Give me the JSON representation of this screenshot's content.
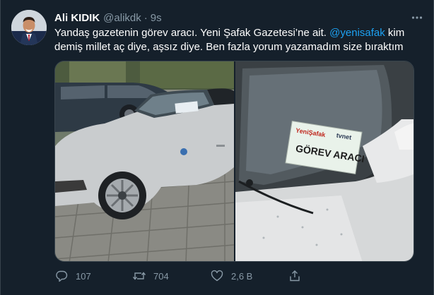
{
  "tweet": {
    "author_name": "Ali KIDIK",
    "author_handle": "@alikdk",
    "separator": "·",
    "time": "9s",
    "text_before": "Yandaş gazetenin görev aracı. Yeni Şafak Gazetesi’ne ait. ",
    "mention": "@yenisafak",
    "text_after": " kim demiş millet aç diye, aşsız diye. Ben fazla yorum yazamadım size bıraktım",
    "more_icon": "more-horizontal-icon"
  },
  "media": {
    "photos": [
      {
        "icon": "car-photo",
        "description_visible": false
      },
      {
        "icon": "windshield-sign-photo",
        "sign_brand": "YeniŞafak",
        "sign_brand2": "tvnet",
        "sign_text": "GÖREV ARACI"
      }
    ]
  },
  "actions": {
    "reply": {
      "icon": "reply-icon",
      "count": "107"
    },
    "retweet": {
      "icon": "retweet-icon",
      "count": "704"
    },
    "like": {
      "icon": "heart-icon",
      "count": "2,6 B"
    },
    "share": {
      "icon": "share-icon",
      "count": ""
    }
  },
  "colors": {
    "background": "#15202b",
    "secondary_text": "#8899a6",
    "link": "#1da1f2",
    "border": "#38444d"
  }
}
